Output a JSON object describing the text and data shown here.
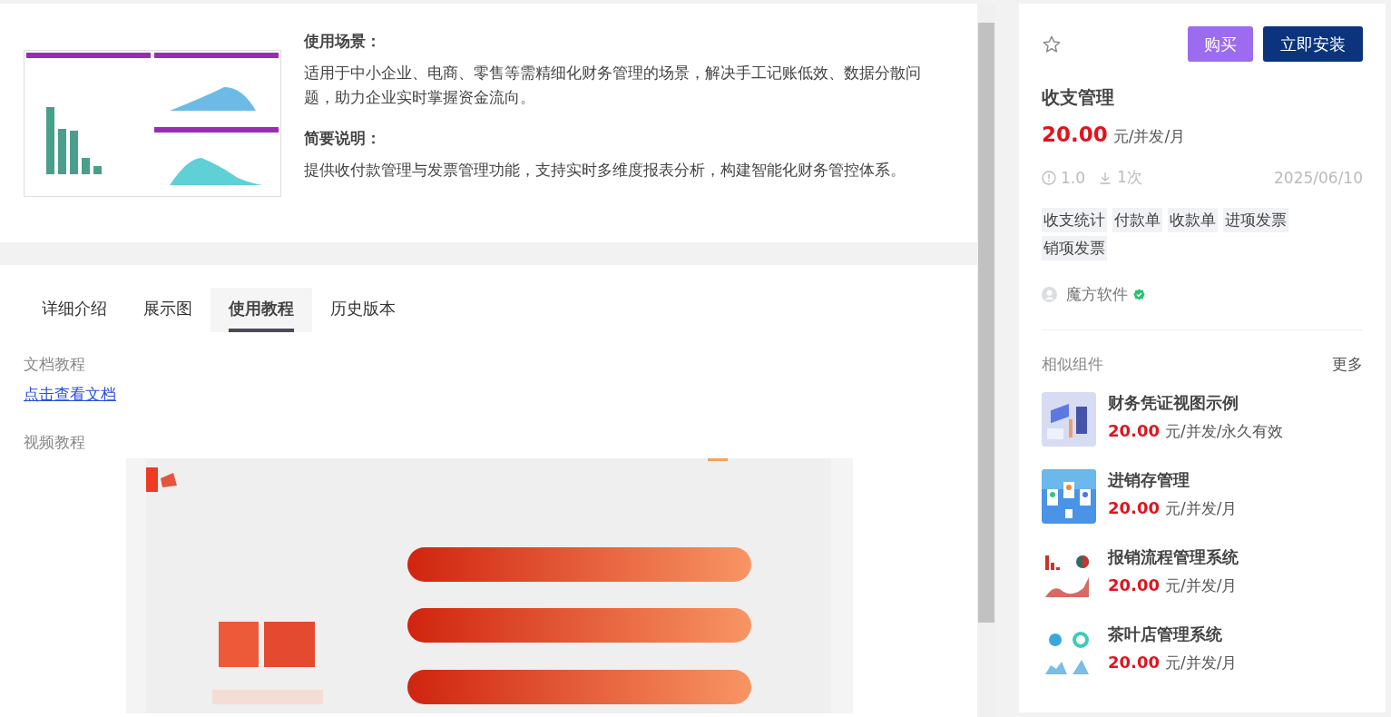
{
  "intro": {
    "sections": [
      {
        "heading": "使用场景：",
        "text": "适用于中小企业、电商、零售等需精细化财务管理的场景，解决手工记账低效、数据分散问题，助力企业实时掌握资金流向。"
      },
      {
        "heading": "简要说明：",
        "text": "提供收付款管理与发票管理功能，支持实时多维度报表分析，构建智能化财务管控体系。"
      }
    ]
  },
  "tabs": [
    {
      "label": "详细介绍",
      "selected": false
    },
    {
      "label": "展示图",
      "selected": false
    },
    {
      "label": "使用教程",
      "selected": true
    },
    {
      "label": "历史版本",
      "selected": false
    }
  ],
  "tutorial": {
    "doc_heading": "文档教程",
    "doc_link": "点击查看文档",
    "video_heading": "视频教程"
  },
  "product": {
    "buttons": [
      {
        "label": "购买",
        "kind": "secondary"
      },
      {
        "label": "立即安装",
        "kind": "primary"
      }
    ],
    "title": "收支管理",
    "price": "20.00",
    "unit": "元/并发/月",
    "version": "1.0",
    "downloads": "1次",
    "date": "2025/06/10",
    "tags": [
      "收支统计",
      "付款单",
      "收款单",
      "进项发票",
      "销项发票"
    ],
    "author": "魔方软件",
    "verified": true
  },
  "similar": {
    "title": "相似组件",
    "more": "更多",
    "items": [
      {
        "name": "财务凭证视图示例",
        "price": "20.00",
        "unit": "元/并发/永久有效",
        "kind": "picture"
      },
      {
        "name": "进销存管理",
        "price": "20.00",
        "unit": "元/并发/月",
        "kind": "picture"
      },
      {
        "name": "报销流程管理系统",
        "price": "20.00",
        "unit": "元/并发/月",
        "kind": "picture"
      },
      {
        "name": "茶叶店管理系统",
        "price": "20.00",
        "unit": "元/并发/月",
        "kind": "picture"
      }
    ]
  }
}
